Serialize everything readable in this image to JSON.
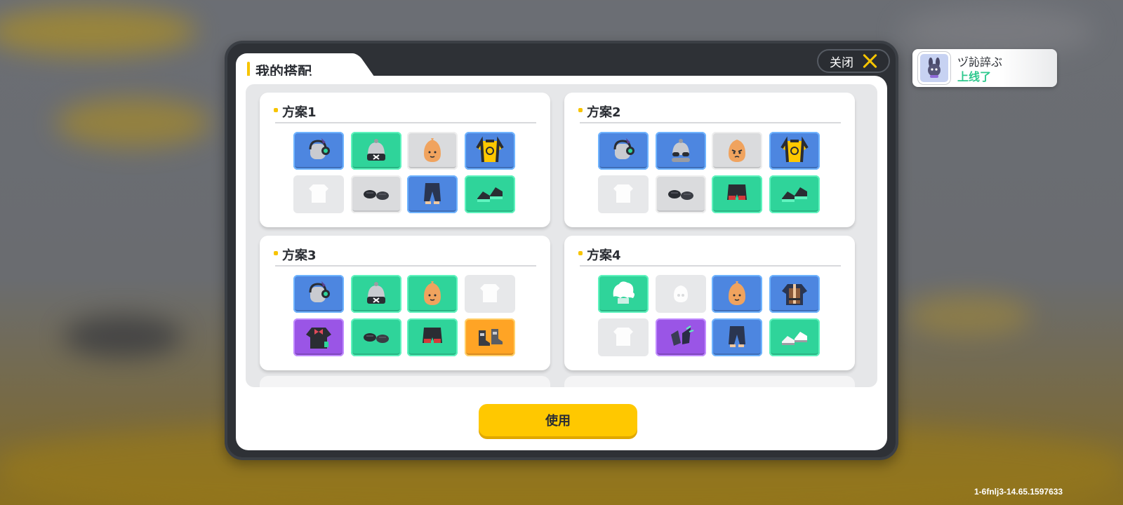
{
  "dialog": {
    "title": "我的搭配",
    "close_label": "关闭",
    "use_label": "使用"
  },
  "outfits": [
    {
      "title": "方案1",
      "slots": [
        {
          "color": "blue",
          "icon": "headphones-hat-icon"
        },
        {
          "color": "green",
          "icon": "beanie-x-icon"
        },
        {
          "color": "gray",
          "icon": "face-icon"
        },
        {
          "color": "blue",
          "icon": "yellow-jacket-icon"
        },
        {
          "color": "empty",
          "icon": "empty-shirt-icon"
        },
        {
          "color": "gray",
          "icon": "gloves-icon"
        },
        {
          "color": "blue",
          "icon": "pants-icon"
        },
        {
          "color": "green",
          "icon": "sneakers-icon"
        }
      ]
    },
    {
      "title": "方案2",
      "slots": [
        {
          "color": "blue",
          "icon": "headphones-hat-icon"
        },
        {
          "color": "blue",
          "icon": "beanie-sunglasses-icon"
        },
        {
          "color": "gray",
          "icon": "angry-face-icon"
        },
        {
          "color": "blue",
          "icon": "yellow-jacket-icon"
        },
        {
          "color": "empty",
          "icon": "empty-shirt-icon"
        },
        {
          "color": "gray",
          "icon": "gloves-icon"
        },
        {
          "color": "green",
          "icon": "shorts-icon"
        },
        {
          "color": "green",
          "icon": "sneakers-icon"
        }
      ]
    },
    {
      "title": "方案3",
      "slots": [
        {
          "color": "blue",
          "icon": "headphones-hat-icon"
        },
        {
          "color": "green",
          "icon": "beanie-x-icon"
        },
        {
          "color": "green",
          "icon": "face-icon"
        },
        {
          "color": "empty",
          "icon": "empty-shirt-icon"
        },
        {
          "color": "purple",
          "icon": "bow-jacket-icon"
        },
        {
          "color": "green",
          "icon": "gloves-icon"
        },
        {
          "color": "green",
          "icon": "shorts-icon"
        },
        {
          "color": "orange",
          "icon": "boots-icon"
        }
      ]
    },
    {
      "title": "方案4",
      "slots": [
        {
          "color": "green",
          "icon": "white-hair-icon"
        },
        {
          "color": "empty",
          "icon": "empty-head-icon"
        },
        {
          "color": "blue",
          "icon": "face-icon"
        },
        {
          "color": "blue",
          "icon": "vest-icon"
        },
        {
          "color": "empty",
          "icon": "empty-shirt-icon"
        },
        {
          "color": "purple",
          "icon": "claw-gloves-icon"
        },
        {
          "color": "blue",
          "icon": "pants-icon"
        },
        {
          "color": "green",
          "icon": "white-sneakers-icon"
        }
      ]
    }
  ],
  "notification": {
    "name": "ヅ訫誶ぶ",
    "status": "上线了",
    "avatar_icon": "bunny-avatar-icon"
  },
  "build_id": "1-6fnlj3-14.65.1597633",
  "colors": {
    "accent": "#ffc800",
    "slot_blue": "#4d86e0",
    "slot_green": "#2fd49a",
    "slot_gray": "#dadbdd",
    "slot_purple": "#9a55e6",
    "slot_orange": "#ffa425",
    "online_green": "#2fc98e"
  }
}
